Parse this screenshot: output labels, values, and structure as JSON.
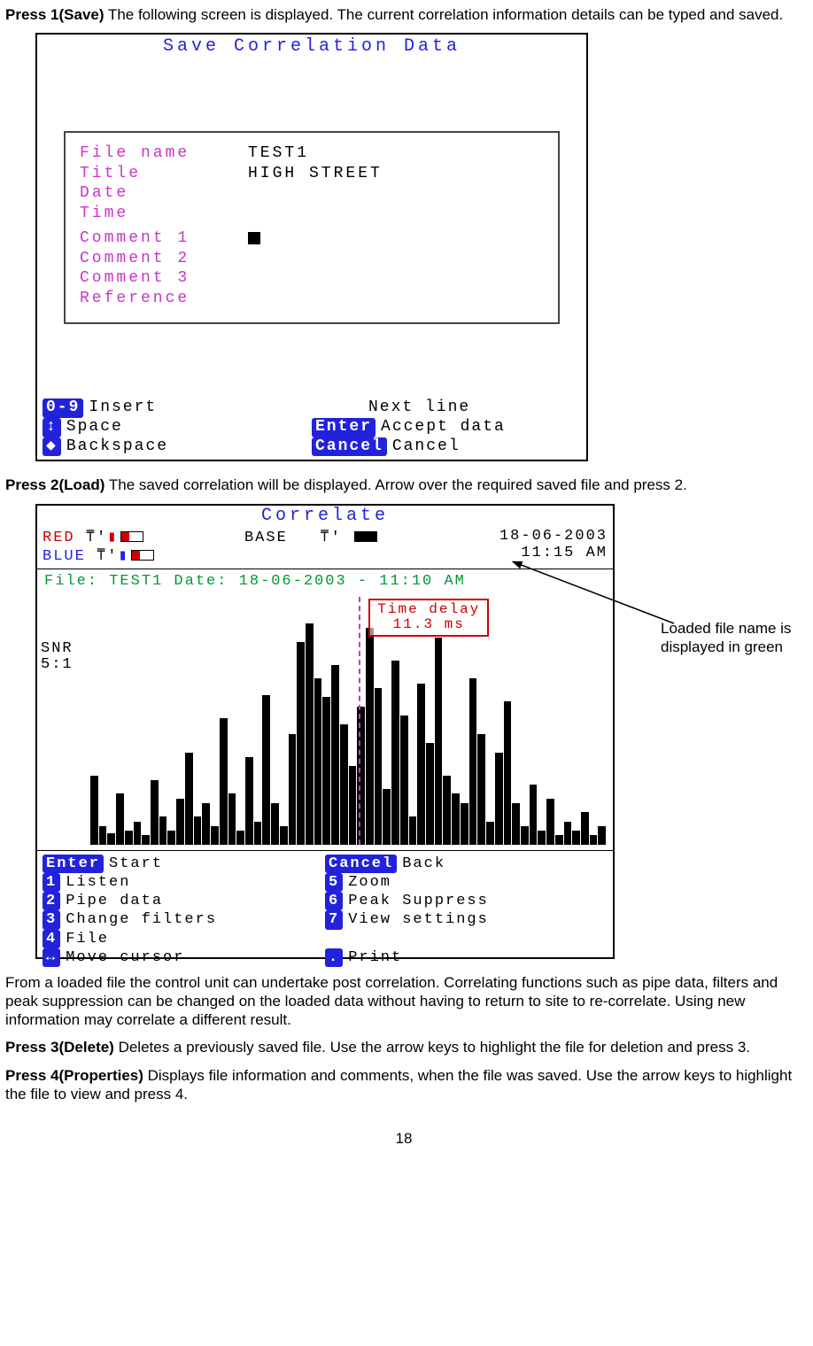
{
  "intro1": {
    "bold": "Press 1(Save)",
    "rest": " The following screen is displayed. The current correlation information details can be typed and saved."
  },
  "screen1": {
    "title": "Save Correlation Data",
    "fields": [
      {
        "label": "File name",
        "value": "TEST1"
      },
      {
        "label": "Title",
        "value": "HIGH STREET"
      },
      {
        "label": "Date",
        "value": ""
      },
      {
        "label": "Time",
        "value": ""
      }
    ],
    "comments": [
      {
        "label": "Comment 1",
        "value": "■"
      },
      {
        "label": "Comment 2",
        "value": ""
      },
      {
        "label": "Comment 3",
        "value": ""
      },
      {
        "label": "Reference",
        "value": ""
      }
    ],
    "keys_left": [
      {
        "cap": "0-9",
        "txt": "Insert"
      },
      {
        "cap": "↕",
        "txt": "Space"
      },
      {
        "cap": "◆",
        "txt": "Backspace"
      }
    ],
    "keys_right": [
      {
        "cap": "",
        "txt": "Next line"
      },
      {
        "cap": "Enter",
        "txt": "Accept data"
      },
      {
        "cap": "Cancel",
        "txt": "Cancel"
      }
    ]
  },
  "intro2": {
    "bold": "Press 2(Load)",
    "rest": " The saved correlation will be displayed. Arrow over the required saved file and press 2."
  },
  "screen2": {
    "title": "Correlate",
    "status": {
      "red": "RED",
      "blue": "BLUE",
      "base": "BASE",
      "date": "18-06-2003",
      "time": "11:15 AM"
    },
    "fileinfo": "File: TEST1 Date: 18-06-2003 - 11:10 AM",
    "snr_label": "SNR",
    "snr_val": "5:1",
    "time_delay_label": "Time delay",
    "time_delay_val": "11.3 ms",
    "keys_left": [
      {
        "cap": "Enter",
        "txt": "Start"
      },
      {
        "cap": "1",
        "txt": "Listen"
      },
      {
        "cap": "2",
        "txt": "Pipe data"
      },
      {
        "cap": "3",
        "txt": "Change filters"
      },
      {
        "cap": "4",
        "txt": "File"
      },
      {
        "cap": "↔",
        "txt": "Move cursor"
      }
    ],
    "keys_right": [
      {
        "cap": "Cancel",
        "txt": "Back"
      },
      {
        "cap": "5",
        "txt": "Zoom"
      },
      {
        "cap": "6",
        "txt": "Peak Suppress"
      },
      {
        "cap": "7",
        "txt": "View settings"
      },
      {
        "cap": "",
        "txt": ""
      },
      {
        "cap": ".",
        "txt": "Print"
      }
    ]
  },
  "annotation": "Loaded file name is displayed in green",
  "para_after": "From a loaded file the control unit can undertake post correlation. Correlating functions such as pipe data, filters and peak suppression can be changed on the loaded data without having to return to site to re-correlate. Using new information may correlate a different result.",
  "intro3": {
    "bold": "Press 3(Delete)",
    "rest": " Deletes a previously saved file. Use the arrow keys to highlight the file for deletion and press 3."
  },
  "intro4": {
    "bold": "Press 4(Properties)",
    "rest": " Displays file information and comments, when the file was saved. Use the arrow keys to highlight the file to view and press 4."
  },
  "pagenum": "18",
  "chart_data": {
    "type": "bar",
    "title": "Correlation histogram (SNR 5:1)",
    "xlabel": "",
    "ylabel": "",
    "ylim": [
      0,
      100
    ],
    "time_delay_ms": 11.3,
    "values": [
      30,
      8,
      5,
      22,
      6,
      10,
      4,
      28,
      12,
      6,
      20,
      40,
      12,
      18,
      8,
      55,
      22,
      6,
      38,
      10,
      65,
      18,
      8,
      48,
      88,
      96,
      72,
      64,
      78,
      52,
      34,
      60,
      94,
      68,
      24,
      80,
      56,
      12,
      70,
      44,
      90,
      30,
      22,
      18,
      72,
      48,
      10,
      40,
      62,
      18,
      8,
      26,
      6,
      20,
      4,
      10,
      6,
      14,
      4,
      8
    ]
  }
}
